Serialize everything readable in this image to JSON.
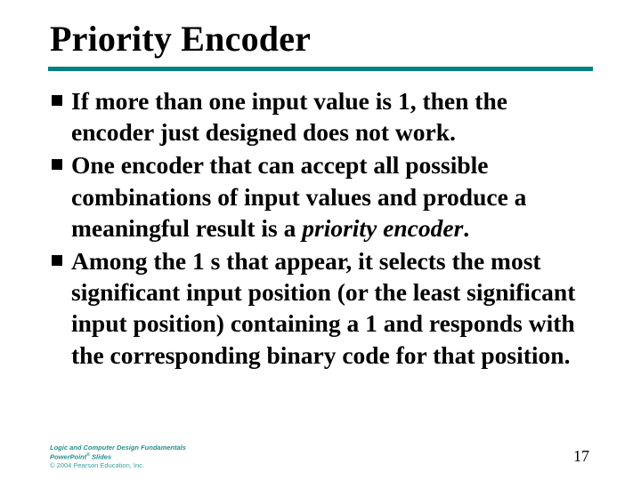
{
  "title": "Priority Encoder",
  "bullets": [
    {
      "text": "If more than one input value is 1, then the encoder just designed does not work."
    },
    {
      "text": "One encoder that can accept all possible combinations of input values and produce a meaningful result is a ",
      "ital": "priority encoder",
      "tail": "."
    },
    {
      "text": "Among the 1 s that appear, it selects the most significant input position (or the least significant input position) containing a 1 and responds with  the corresponding binary code for that position."
    }
  ],
  "footer": {
    "line1": "Logic and Computer Design Fundamentals",
    "line2_a": "PowerPoint",
    "line2_sup": "®",
    "line2_b": " Slides",
    "line3": "© 2004 Pearson Education, Inc."
  },
  "page_number": "17"
}
